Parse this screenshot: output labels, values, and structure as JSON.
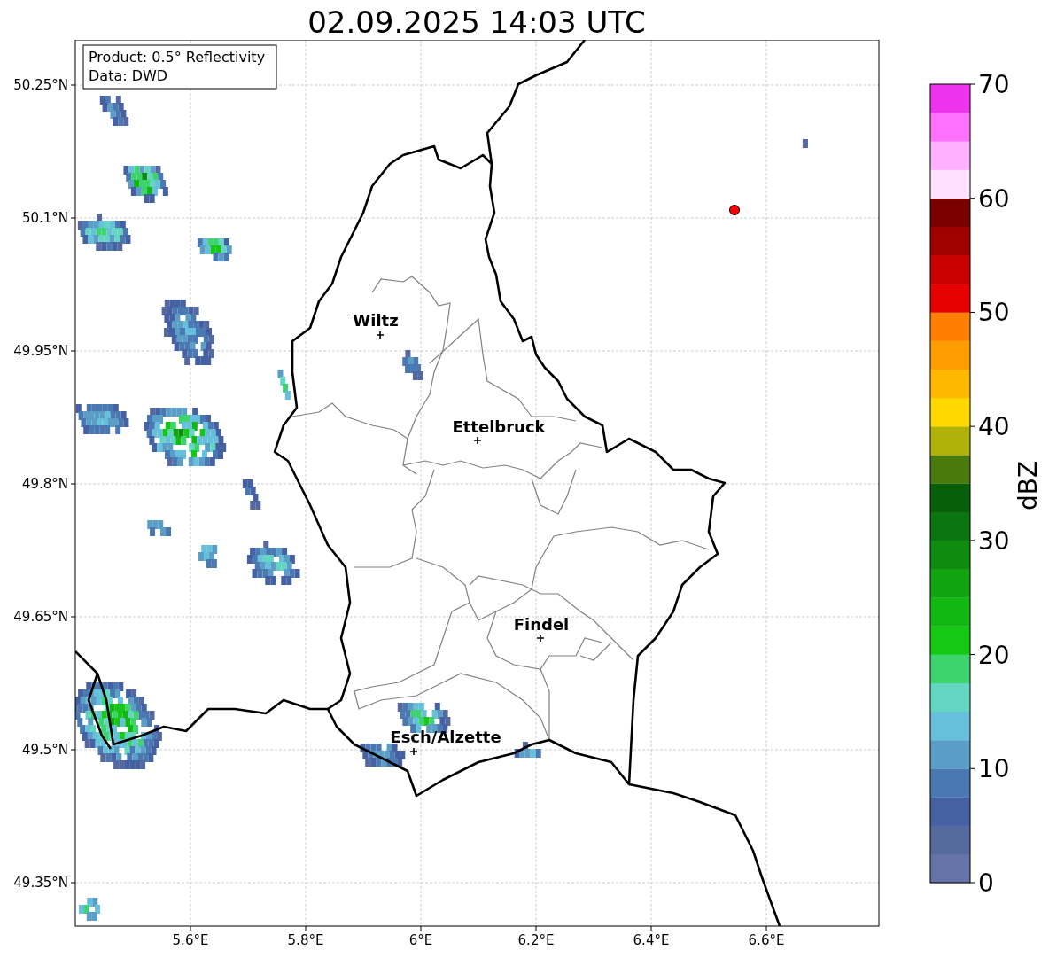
{
  "title": "02.09.2025 14:03 UTC",
  "legend": [
    "Product: 0.5° Reflectivity",
    "Data: DWD"
  ],
  "map": {
    "y_ticks": [
      "50.25°N",
      "50.1°N",
      "49.95°N",
      "49.8°N",
      "49.65°N",
      "49.5°N",
      "49.35°N"
    ],
    "x_ticks": [
      "5.6°E",
      "5.8°E",
      "6°E",
      "6.2°E",
      "6.4°E",
      "6.6°E"
    ],
    "cities": [
      {
        "name": "Wiltz"
      },
      {
        "name": "Ettelbruck"
      },
      {
        "name": "Findel"
      },
      {
        "name": "Esch/Alzette"
      }
    ]
  },
  "colorbar": {
    "label": "dBZ",
    "ticks": [
      "70",
      "60",
      "50",
      "40",
      "30",
      "20",
      "10",
      "0"
    ],
    "bands": [
      {
        "color": "#6474a8"
      },
      {
        "color": "#56699f"
      },
      {
        "color": "#4560a3"
      },
      {
        "color": "#4a78b2"
      },
      {
        "color": "#5a9ec8"
      },
      {
        "color": "#66c0dc"
      },
      {
        "color": "#63d6c2"
      },
      {
        "color": "#3dd46d"
      },
      {
        "color": "#14c814"
      },
      {
        "color": "#12b812"
      },
      {
        "color": "#10a510"
      },
      {
        "color": "#0f8c0f"
      },
      {
        "color": "#0b760f"
      },
      {
        "color": "#075e0b"
      },
      {
        "color": "#4a7a0b"
      },
      {
        "color": "#b0b20a"
      },
      {
        "color": "#ffd800"
      },
      {
        "color": "#ffb800"
      },
      {
        "color": "#ff9c00"
      },
      {
        "color": "#ff8000"
      },
      {
        "color": "#e60000"
      },
      {
        "color": "#c80000"
      },
      {
        "color": "#a00000"
      },
      {
        "color": "#7a0000"
      },
      {
        "color": "#ffe0ff"
      },
      {
        "color": "#ffb0ff"
      },
      {
        "color": "#ff70ff"
      },
      {
        "color": "#ee33ee"
      }
    ]
  }
}
